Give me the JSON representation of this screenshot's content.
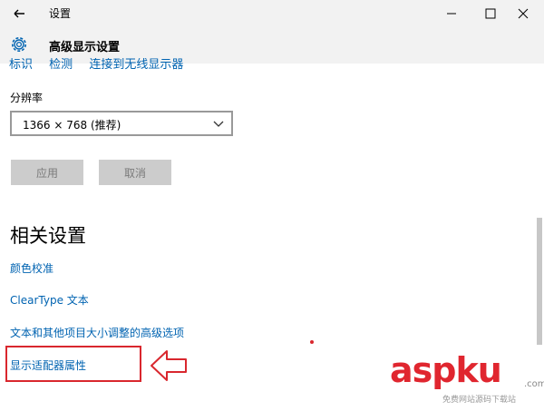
{
  "window": {
    "title": "设置"
  },
  "header": {
    "title": "高级显示设置"
  },
  "cut_links": [
    "标识",
    "检测",
    "连接到无线显示器"
  ],
  "resolution": {
    "label": "分辨率",
    "value": "1366 × 768 (推荐)"
  },
  "buttons": {
    "apply": "应用",
    "cancel": "取消"
  },
  "related": {
    "title": "相关设置",
    "links": [
      "颜色校准",
      "ClearType 文本",
      "文本和其他项目大小调整的高级选项",
      "显示适配器属性"
    ]
  },
  "watermark": {
    "main": "aspku",
    "tld": ".com",
    "sub": "免费网站源码下载站"
  },
  "colors": {
    "accent": "#0063b1",
    "highlight": "#d9272e",
    "titlebar": "#f2f2f2"
  },
  "icons": [
    "back-arrow-icon",
    "minimize-icon",
    "maximize-icon",
    "close-icon",
    "gear-icon",
    "chevron-down-icon",
    "arrow-left-icon"
  ]
}
